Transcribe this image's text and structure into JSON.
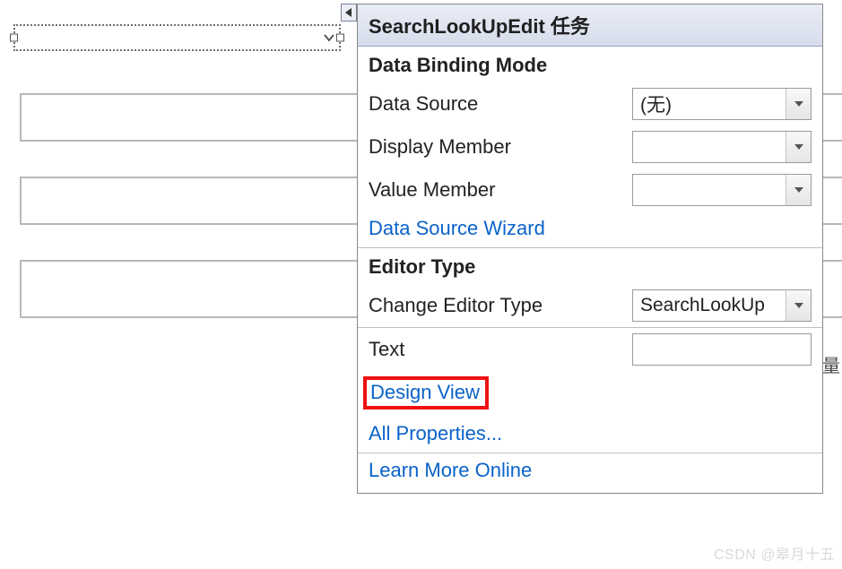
{
  "designer": {
    "selected_control_value": ""
  },
  "smart_tag": {
    "title": "SearchLookUpEdit 任务"
  },
  "sections": {
    "binding_title": "Data Binding Mode",
    "editor_title": "Editor Type"
  },
  "fields": {
    "data_source": {
      "label": "Data Source",
      "value": "(无)"
    },
    "display_member": {
      "label": "Display Member",
      "value": ""
    },
    "value_member": {
      "label": "Value Member",
      "value": ""
    },
    "change_editor_type": {
      "label": "Change Editor Type",
      "value": "SearchLookUp"
    },
    "text": {
      "label": "Text",
      "value": ""
    }
  },
  "links": {
    "data_source_wizard": "Data Source Wizard",
    "design_view": "Design View",
    "all_properties": "All Properties...",
    "learn_more": "Learn More Online"
  },
  "stray": "量",
  "watermark": "CSDN @皋月十五"
}
